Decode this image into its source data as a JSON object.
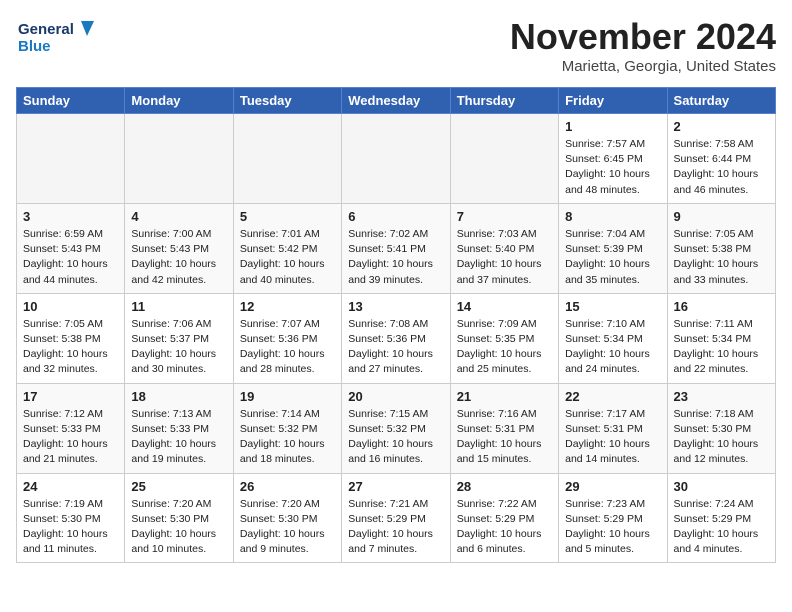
{
  "logo": {
    "line1": "General",
    "line2": "Blue"
  },
  "title": "November 2024",
  "location": "Marietta, Georgia, United States",
  "weekdays": [
    "Sunday",
    "Monday",
    "Tuesday",
    "Wednesday",
    "Thursday",
    "Friday",
    "Saturday"
  ],
  "weeks": [
    [
      {
        "day": "",
        "info": ""
      },
      {
        "day": "",
        "info": ""
      },
      {
        "day": "",
        "info": ""
      },
      {
        "day": "",
        "info": ""
      },
      {
        "day": "",
        "info": ""
      },
      {
        "day": "1",
        "info": "Sunrise: 7:57 AM\nSunset: 6:45 PM\nDaylight: 10 hours\nand 48 minutes."
      },
      {
        "day": "2",
        "info": "Sunrise: 7:58 AM\nSunset: 6:44 PM\nDaylight: 10 hours\nand 46 minutes."
      }
    ],
    [
      {
        "day": "3",
        "info": "Sunrise: 6:59 AM\nSunset: 5:43 PM\nDaylight: 10 hours\nand 44 minutes."
      },
      {
        "day": "4",
        "info": "Sunrise: 7:00 AM\nSunset: 5:43 PM\nDaylight: 10 hours\nand 42 minutes."
      },
      {
        "day": "5",
        "info": "Sunrise: 7:01 AM\nSunset: 5:42 PM\nDaylight: 10 hours\nand 40 minutes."
      },
      {
        "day": "6",
        "info": "Sunrise: 7:02 AM\nSunset: 5:41 PM\nDaylight: 10 hours\nand 39 minutes."
      },
      {
        "day": "7",
        "info": "Sunrise: 7:03 AM\nSunset: 5:40 PM\nDaylight: 10 hours\nand 37 minutes."
      },
      {
        "day": "8",
        "info": "Sunrise: 7:04 AM\nSunset: 5:39 PM\nDaylight: 10 hours\nand 35 minutes."
      },
      {
        "day": "9",
        "info": "Sunrise: 7:05 AM\nSunset: 5:38 PM\nDaylight: 10 hours\nand 33 minutes."
      }
    ],
    [
      {
        "day": "10",
        "info": "Sunrise: 7:05 AM\nSunset: 5:38 PM\nDaylight: 10 hours\nand 32 minutes."
      },
      {
        "day": "11",
        "info": "Sunrise: 7:06 AM\nSunset: 5:37 PM\nDaylight: 10 hours\nand 30 minutes."
      },
      {
        "day": "12",
        "info": "Sunrise: 7:07 AM\nSunset: 5:36 PM\nDaylight: 10 hours\nand 28 minutes."
      },
      {
        "day": "13",
        "info": "Sunrise: 7:08 AM\nSunset: 5:36 PM\nDaylight: 10 hours\nand 27 minutes."
      },
      {
        "day": "14",
        "info": "Sunrise: 7:09 AM\nSunset: 5:35 PM\nDaylight: 10 hours\nand 25 minutes."
      },
      {
        "day": "15",
        "info": "Sunrise: 7:10 AM\nSunset: 5:34 PM\nDaylight: 10 hours\nand 24 minutes."
      },
      {
        "day": "16",
        "info": "Sunrise: 7:11 AM\nSunset: 5:34 PM\nDaylight: 10 hours\nand 22 minutes."
      }
    ],
    [
      {
        "day": "17",
        "info": "Sunrise: 7:12 AM\nSunset: 5:33 PM\nDaylight: 10 hours\nand 21 minutes."
      },
      {
        "day": "18",
        "info": "Sunrise: 7:13 AM\nSunset: 5:33 PM\nDaylight: 10 hours\nand 19 minutes."
      },
      {
        "day": "19",
        "info": "Sunrise: 7:14 AM\nSunset: 5:32 PM\nDaylight: 10 hours\nand 18 minutes."
      },
      {
        "day": "20",
        "info": "Sunrise: 7:15 AM\nSunset: 5:32 PM\nDaylight: 10 hours\nand 16 minutes."
      },
      {
        "day": "21",
        "info": "Sunrise: 7:16 AM\nSunset: 5:31 PM\nDaylight: 10 hours\nand 15 minutes."
      },
      {
        "day": "22",
        "info": "Sunrise: 7:17 AM\nSunset: 5:31 PM\nDaylight: 10 hours\nand 14 minutes."
      },
      {
        "day": "23",
        "info": "Sunrise: 7:18 AM\nSunset: 5:30 PM\nDaylight: 10 hours\nand 12 minutes."
      }
    ],
    [
      {
        "day": "24",
        "info": "Sunrise: 7:19 AM\nSunset: 5:30 PM\nDaylight: 10 hours\nand 11 minutes."
      },
      {
        "day": "25",
        "info": "Sunrise: 7:20 AM\nSunset: 5:30 PM\nDaylight: 10 hours\nand 10 minutes."
      },
      {
        "day": "26",
        "info": "Sunrise: 7:20 AM\nSunset: 5:30 PM\nDaylight: 10 hours\nand 9 minutes."
      },
      {
        "day": "27",
        "info": "Sunrise: 7:21 AM\nSunset: 5:29 PM\nDaylight: 10 hours\nand 7 minutes."
      },
      {
        "day": "28",
        "info": "Sunrise: 7:22 AM\nSunset: 5:29 PM\nDaylight: 10 hours\nand 6 minutes."
      },
      {
        "day": "29",
        "info": "Sunrise: 7:23 AM\nSunset: 5:29 PM\nDaylight: 10 hours\nand 5 minutes."
      },
      {
        "day": "30",
        "info": "Sunrise: 7:24 AM\nSunset: 5:29 PM\nDaylight: 10 hours\nand 4 minutes."
      }
    ]
  ]
}
